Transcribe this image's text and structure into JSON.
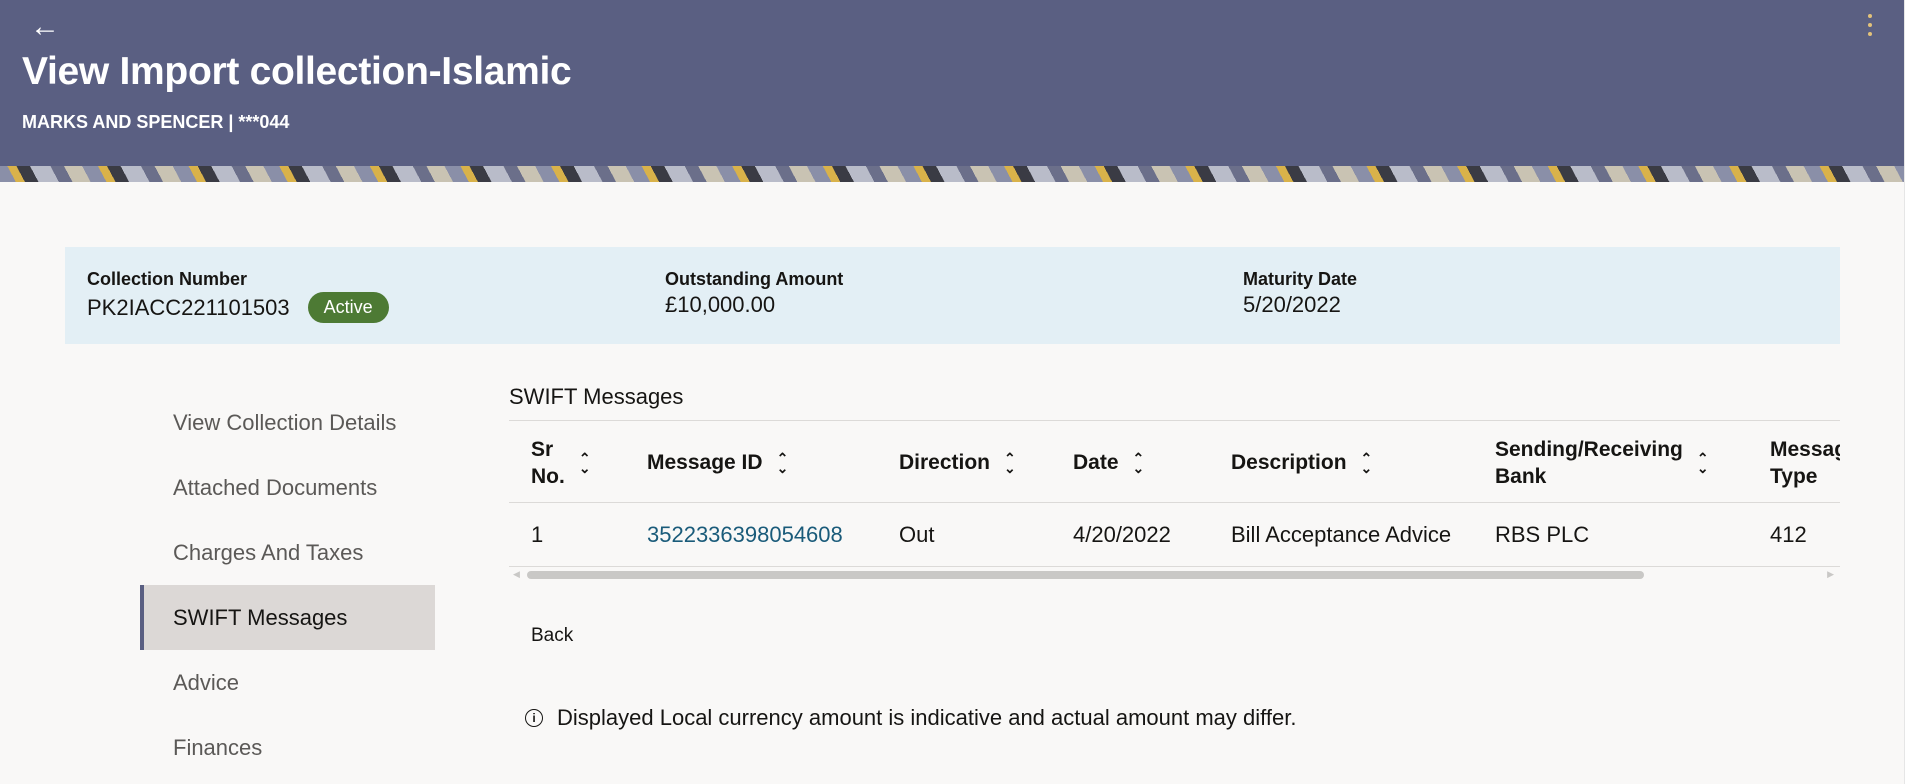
{
  "header": {
    "back_icon": "arrow-left-icon",
    "menu_icon": "kebab-menu-icon",
    "title": "View Import collection-Islamic",
    "subtitle": "MARKS AND SPENCER | ***044"
  },
  "summary": {
    "collection_number_label": "Collection Number",
    "collection_number": "PK2IACC221101503",
    "status": "Active",
    "outstanding_label": "Outstanding Amount",
    "outstanding_amount": "£10,000.00",
    "maturity_label": "Maturity Date",
    "maturity_date": "5/20/2022"
  },
  "sidenav": {
    "items": [
      {
        "label": "View Collection Details"
      },
      {
        "label": "Attached Documents"
      },
      {
        "label": "Charges And Taxes"
      },
      {
        "label": "SWIFT Messages"
      },
      {
        "label": "Advice"
      },
      {
        "label": "Finances"
      }
    ],
    "active": "SWIFT Messages"
  },
  "swift": {
    "title": "SWIFT Messages",
    "columns": [
      {
        "line1": "Sr",
        "line2": "No."
      },
      {
        "line1": "Message ID",
        "line2": ""
      },
      {
        "line1": "Direction",
        "line2": ""
      },
      {
        "line1": "Date",
        "line2": ""
      },
      {
        "line1": "Description",
        "line2": ""
      },
      {
        "line1": "Sending/Receiving",
        "line2": "Bank"
      },
      {
        "line1": "Message",
        "line2": "Type"
      }
    ],
    "rows": [
      {
        "sr_no": "1",
        "message_id": "3522336398054608",
        "direction": "Out",
        "date": "4/20/2022",
        "description": "Bill Acceptance Advice",
        "bank": "RBS PLC",
        "message_type": "412"
      }
    ]
  },
  "back_button": "Back",
  "note": {
    "icon": "info-icon",
    "text": "Displayed Local currency amount is indicative and actual amount may differ."
  },
  "colors": {
    "header_bg": "#5a5f82",
    "summary_bg": "#e3eff5",
    "active_badge": "#4d7a34",
    "link": "#1a5b7a",
    "active_nav_bg": "#dcd8d6"
  }
}
